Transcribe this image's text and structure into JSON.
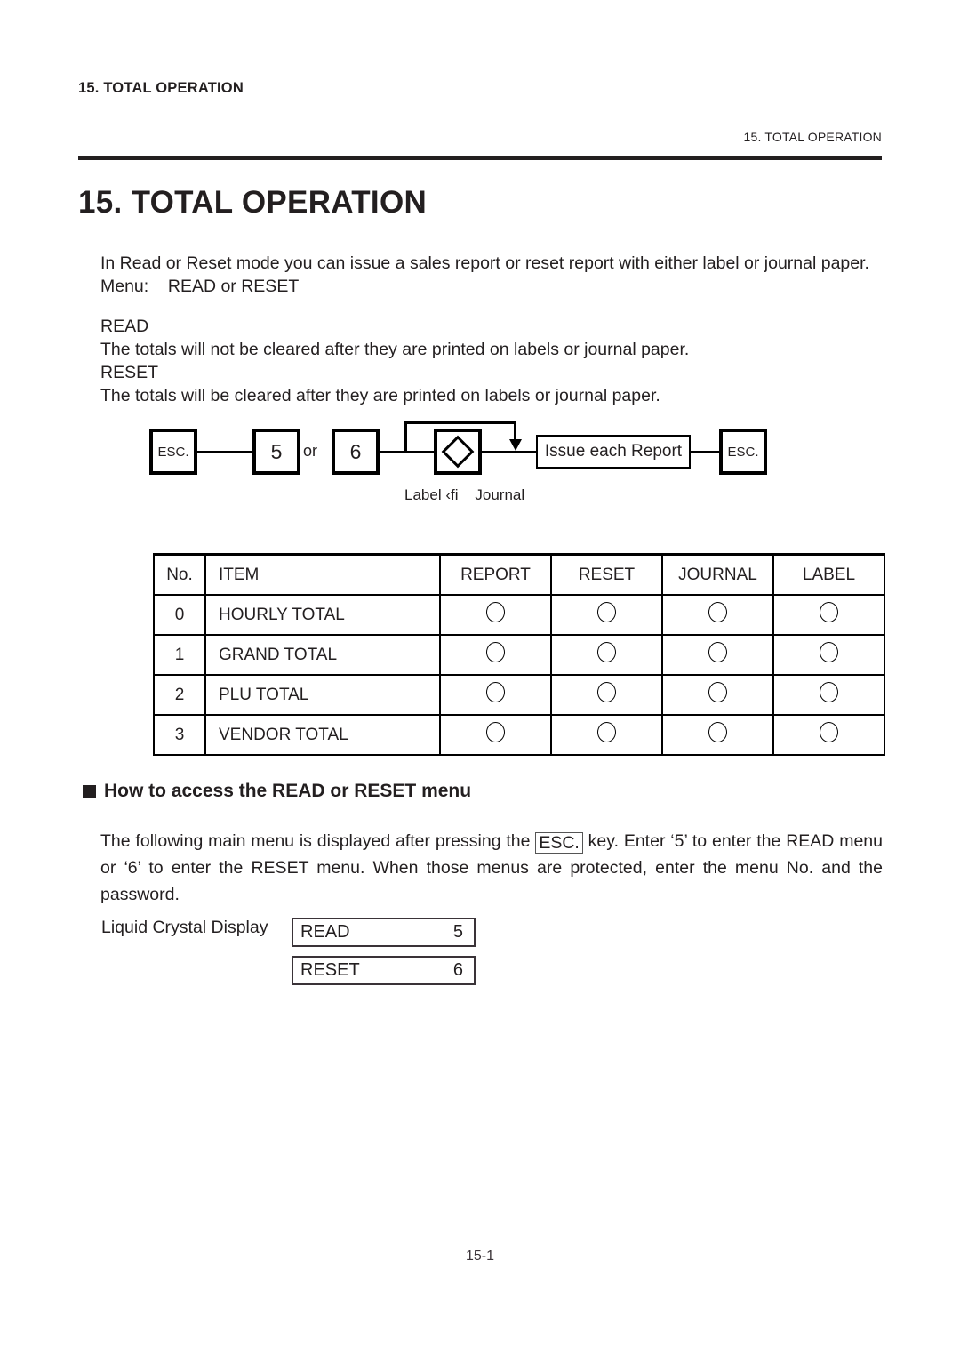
{
  "header": {
    "left_running_head": "15. TOTAL OPERATION",
    "right_running_head": "15.  TOTAL OPERATION"
  },
  "chapter": {
    "title": "15.  TOTAL OPERATION"
  },
  "intro": {
    "line1": "In Read or Reset mode you can issue a sales report or reset report with either label or journal paper.",
    "line2": "Menu:    READ or RESET",
    "line3": "READ",
    "line4": "The totals will not be cleared after they are printed on labels or journal paper.",
    "line5": "RESET",
    "line6": "The totals will be cleared after they are printed on labels or journal paper."
  },
  "flow": {
    "esc_start": "ESC.",
    "key_5": "5",
    "or": "or",
    "key_6": "6",
    "selector": "◇",
    "issue_report": "Issue each Report",
    "esc_end": "ESC.",
    "caption": "Label ‹fi    Journal"
  },
  "table": {
    "headers": [
      "No.",
      "ITEM",
      "REPORT",
      "RESET",
      "JOURNAL",
      "LABEL"
    ],
    "rows": [
      {
        "no": "0",
        "item": "HOURLY TOTAL",
        "report": "○",
        "reset": "○",
        "journal": "○",
        "label": "○"
      },
      {
        "no": "1",
        "item": "GRAND TOTAL",
        "report": "○",
        "reset": "○",
        "journal": "○",
        "label": "○"
      },
      {
        "no": "2",
        "item": "PLU TOTAL",
        "report": "○",
        "reset": "○",
        "journal": "○",
        "label": "○"
      },
      {
        "no": "3",
        "item": "VENDOR TOTAL",
        "report": "○",
        "reset": "○",
        "journal": "○",
        "label": "○"
      }
    ]
  },
  "section": {
    "heading": "How to access the READ or RESET menu",
    "para_part1": "The following main menu is displayed after pressing the ",
    "para_key": "ESC.",
    "para_part2": " key.  Enter ‘5’ to enter the READ menu or ‘6’ to enter the RESET menu.  When those menus are protected, enter the menu No. and the password."
  },
  "lcd": {
    "label": "Liquid Crystal Display",
    "rows": [
      {
        "name": "READ",
        "value": "5"
      },
      {
        "name": "RESET",
        "value": "6"
      }
    ]
  },
  "footer": {
    "page_number": "15-1"
  }
}
